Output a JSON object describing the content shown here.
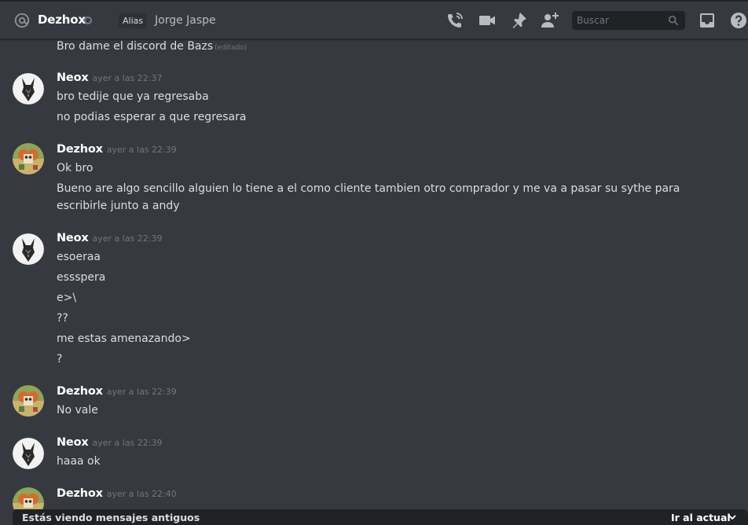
{
  "header": {
    "icon": "at-sign-icon",
    "name": "Dezhox",
    "alias_label": "Alias",
    "alias_value": "Jorge Jaspe",
    "search_placeholder": "Buscar",
    "icons": [
      "phone-call-icon",
      "video-call-icon",
      "pin-icon",
      "add-friend-icon",
      "search-icon",
      "inbox-icon",
      "help-icon"
    ]
  },
  "messages": [
    {
      "continuation": true,
      "lines": [
        {
          "text": "Bro dame el discord de Bazs",
          "edited": "(editado)"
        }
      ]
    },
    {
      "author": "Neox",
      "timestamp": "ayer a las 22:37",
      "lines": [
        {
          "text": "bro tedije que ya regresaba"
        },
        {
          "text": "no podias esperar a que regresara"
        }
      ]
    },
    {
      "author": "Dezhox",
      "timestamp": "ayer a las 22:39",
      "lines": [
        {
          "text": "Ok bro"
        },
        {
          "text": "Bueno are algo sencillo alguien lo tiene a el como cliente tambien otro comprador y me va   a pasar su sythe para escribirle junto a andy"
        }
      ]
    },
    {
      "author": "Neox",
      "timestamp": "ayer a las 22:39",
      "lines": [
        {
          "text": "esoeraa"
        },
        {
          "text": "essspera"
        },
        {
          "text": "e>\\"
        },
        {
          "text": "??"
        },
        {
          "text": "me estas amenazando>"
        },
        {
          "text": "?"
        }
      ]
    },
    {
      "author": "Dezhox",
      "timestamp": "ayer a las 22:39",
      "lines": [
        {
          "text": "No vale"
        }
      ]
    },
    {
      "author": "Neox",
      "timestamp": "ayer a las 22:39",
      "lines": [
        {
          "text": "haaa ok"
        }
      ]
    },
    {
      "author": "Dezhox",
      "timestamp": "ayer a las 22:40",
      "lines": []
    }
  ],
  "bottom_bar": {
    "notice": "Estás viendo mensajes antiguos",
    "jump": "Ir al actual"
  },
  "colors": {
    "background": "#36393f",
    "header_dark": "#202225",
    "text_primary": "#dcddde",
    "muted": "#72767d"
  }
}
